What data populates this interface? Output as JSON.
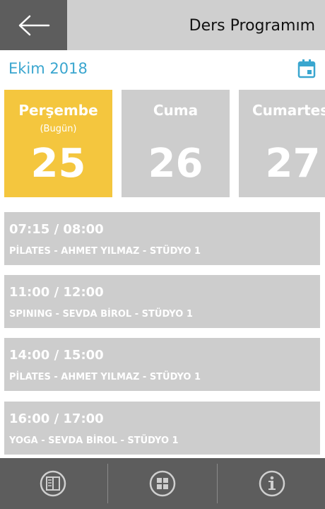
{
  "header": {
    "title": "Ders Programım",
    "back_icon": "arrow-left-icon"
  },
  "month": {
    "label": "Ekim 2018",
    "icon": "calendar-icon",
    "accent": "#3aa6cf"
  },
  "days": [
    {
      "name": "Perşembe",
      "sub": "(Bugün)",
      "num": "25",
      "today": true
    },
    {
      "name": "Cuma",
      "sub": "",
      "num": "26",
      "today": false
    },
    {
      "name": "Cumartesi",
      "sub": "",
      "num": "27",
      "today": false
    }
  ],
  "classes": [
    {
      "time": "07:15 / 08:00",
      "desc": "PİLATES - AHMET YILMAZ - STÜDYO 1"
    },
    {
      "time": "11:00 / 12:00",
      "desc": "SPINING - SEVDA BİROL - STÜDYO 1"
    },
    {
      "time": "14:00 / 15:00",
      "desc": "PİLATES - AHMET YILMAZ - STÜDYO 1"
    },
    {
      "time": "16:00 / 17:00",
      "desc": "YOGA - SEVDA BİROL - STÜDYO 1"
    }
  ],
  "bottom_nav": [
    {
      "icon": "book-icon"
    },
    {
      "icon": "grid-icon"
    },
    {
      "icon": "info-icon"
    }
  ],
  "colors": {
    "today": "#f4c63e",
    "card": "#cdcdcd",
    "bar": "#5d5d5d"
  }
}
